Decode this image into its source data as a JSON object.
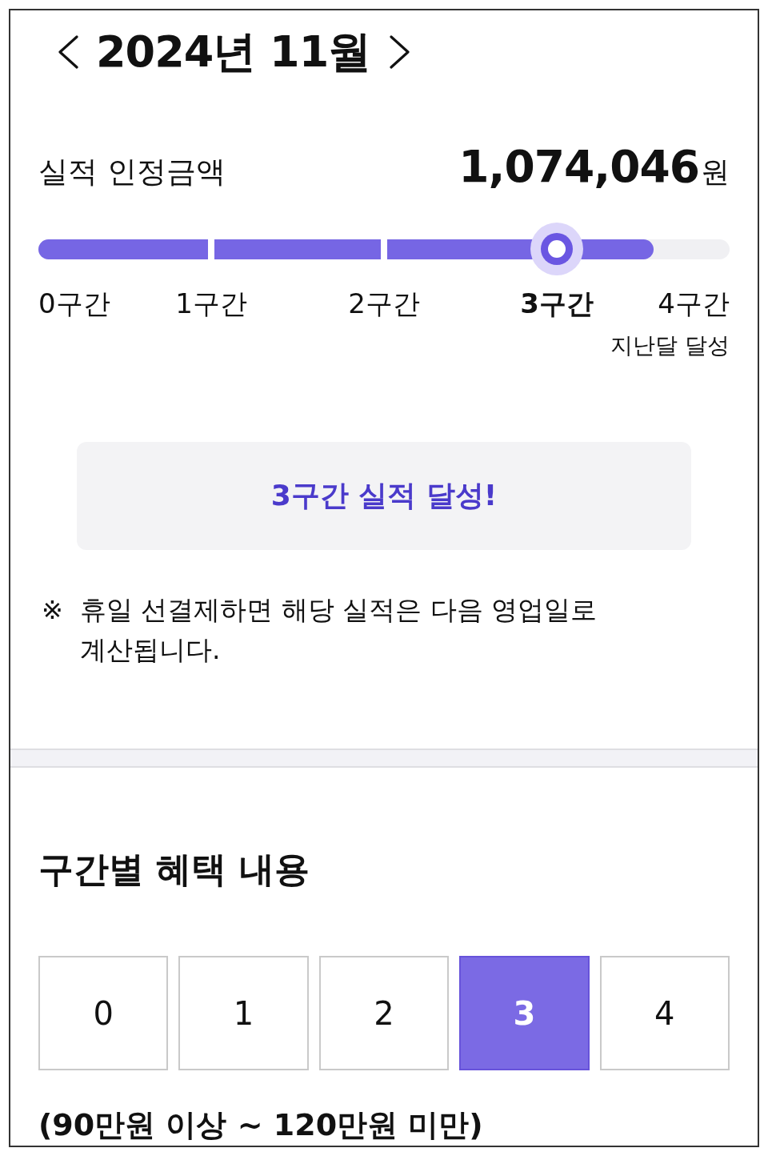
{
  "header": {
    "title": "2024년 11월"
  },
  "performance": {
    "label": "실적 인정금액",
    "amount": "1,074,046",
    "unit": "원"
  },
  "progress": {
    "level": 0.89,
    "sections": [
      {
        "label": "0구간",
        "selected": false
      },
      {
        "label": "1구간",
        "selected": false
      },
      {
        "label": "2구간",
        "selected": false
      },
      {
        "label": "3구간",
        "selected": true
      },
      {
        "label": "4구간",
        "selected": false,
        "note": "지난달 달성"
      }
    ]
  },
  "banner": {
    "message": "3구간 실적 달성!"
  },
  "notice": {
    "mark": "※",
    "text": "휴일 선결제하면 해당 실적은 다음 영업일로 계산됩니다."
  },
  "benefits": {
    "title": "구간별 혜택 내용",
    "tabs": [
      {
        "label": "0",
        "selected": false
      },
      {
        "label": "1",
        "selected": false
      },
      {
        "label": "2",
        "selected": false
      },
      {
        "label": "3",
        "selected": true
      },
      {
        "label": "4",
        "selected": false
      }
    ],
    "range": "(90만원 이상 ~ 120만원 미만)"
  }
}
